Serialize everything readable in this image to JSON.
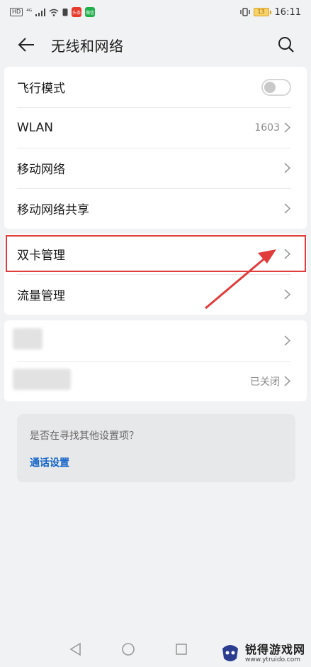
{
  "status_bar": {
    "left_tags": [
      "HD",
      "⁴ᴳ"
    ],
    "app_badges": [
      {
        "label": "头条",
        "color": "#e8392b"
      },
      {
        "label": "微信",
        "color": "#21b04b"
      }
    ],
    "battery": "13",
    "time": "16:11"
  },
  "header": {
    "title": "无线和网络"
  },
  "section1": {
    "items": [
      {
        "label": "飞行模式",
        "toggle": "off"
      },
      {
        "label": "WLAN",
        "value": "1603"
      },
      {
        "label": "移动网络"
      },
      {
        "label": "移动网络共享"
      }
    ]
  },
  "section2": {
    "items": [
      {
        "label": "双卡管理"
      },
      {
        "label": "流量管理"
      }
    ]
  },
  "section3": {
    "items": [
      {
        "label": ""
      },
      {
        "label": "",
        "value": "已关闭"
      }
    ]
  },
  "suggestion": {
    "question": "是否在寻找其他设置项？",
    "link": "通话设置"
  },
  "watermark": {
    "cn": "锐得游戏网",
    "url": "www.ytruido.com"
  },
  "colors": {
    "highlight": "#e03c3c",
    "link": "#1464c8",
    "background": "#f1f2f4"
  }
}
